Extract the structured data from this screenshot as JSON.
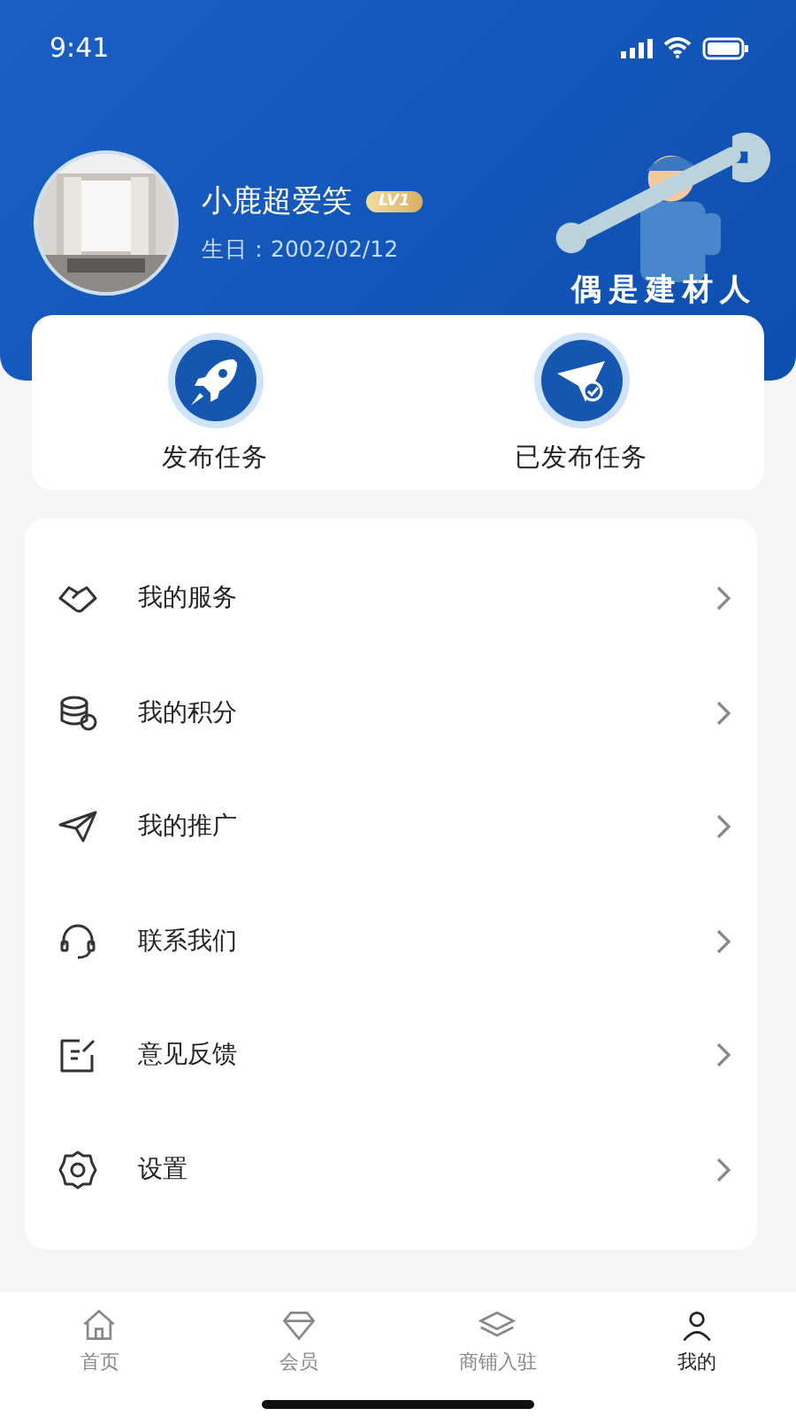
{
  "status_bar": {
    "time": "9:41"
  },
  "profile": {
    "name": "小鹿超爱笑",
    "level_badge": "LV1",
    "birthday": "生日：2002/02/12",
    "slogan": "偶是建材人"
  },
  "quick_actions": [
    {
      "label": "发布任务",
      "kind": "rocket"
    },
    {
      "label": "已发布任务",
      "kind": "plane"
    }
  ],
  "menu": [
    {
      "label": "我的服务",
      "kind": "handshake"
    },
    {
      "label": "我的积分",
      "kind": "coins"
    },
    {
      "label": "我的推广",
      "kind": "send"
    },
    {
      "label": "联系我们",
      "kind": "headset"
    },
    {
      "label": "意见反馈",
      "kind": "edit"
    },
    {
      "label": "设置",
      "kind": "gear"
    }
  ],
  "tabs": [
    {
      "label": "首页",
      "kind": "home",
      "selected": false
    },
    {
      "label": "会员",
      "kind": "diamond",
      "selected": false
    },
    {
      "label": "商铺入驻",
      "kind": "shop",
      "selected": false
    },
    {
      "label": "我的",
      "kind": "user",
      "selected": true
    }
  ]
}
